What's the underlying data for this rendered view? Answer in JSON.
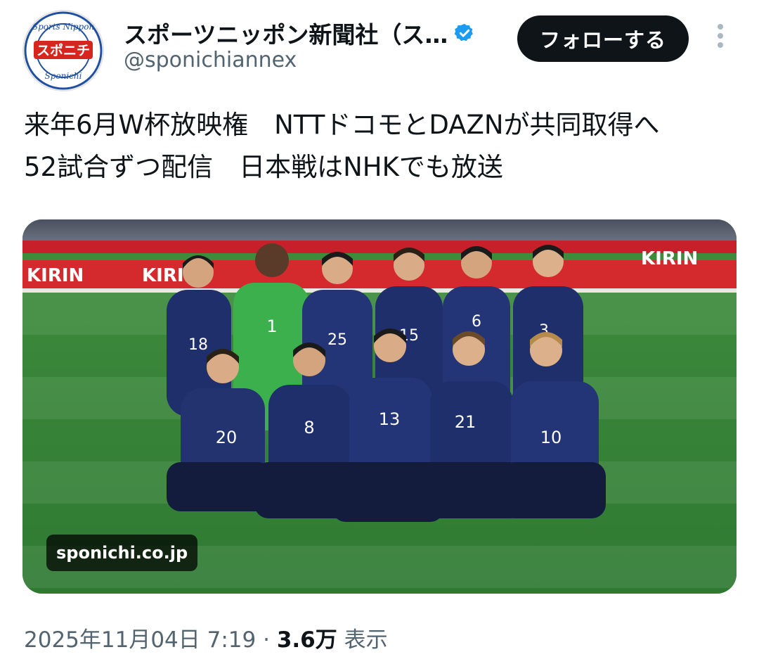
{
  "author": {
    "display_name": "スポーツニッポン新聞社（ス…",
    "handle": "@sponichiannex",
    "avatar_text_top": "Sports Nippon",
    "avatar_text_mid": "スポニチ",
    "avatar_text_bottom": "Sponichi",
    "verified_color": "#1d9bf0"
  },
  "actions": {
    "follow_label": "フォローする",
    "more_icon": "more-vertical-icon"
  },
  "tweet": {
    "line1": "来年6月W杯放映権　NTTドコモとDAZNが共同取得へ",
    "line2": "52試合ずつ配信　日本戦はNHKでも放送"
  },
  "media": {
    "source_label": "sponichi.co.jp",
    "board_text": "KIRIN",
    "back_row_numbers": [
      "18",
      "1",
      "25",
      "15",
      "6",
      "3"
    ],
    "front_row_numbers": [
      "20",
      "8",
      "13",
      "21",
      "10"
    ]
  },
  "meta": {
    "date": "2025年11月04日 7:19",
    "separator": " · ",
    "views_count": "3.6万",
    "views_label": " 表示"
  }
}
